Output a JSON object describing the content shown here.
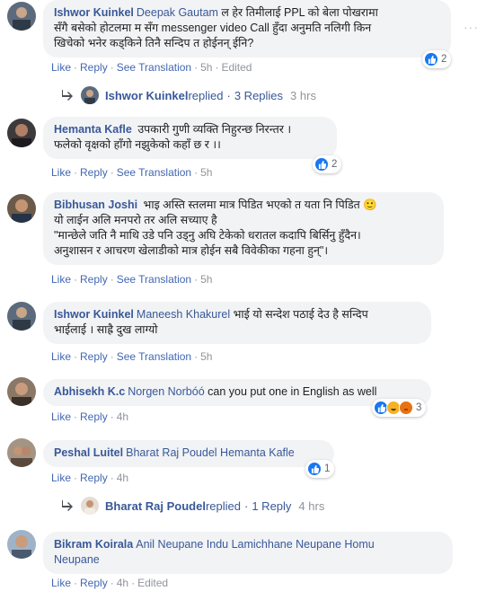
{
  "comments": [
    {
      "author": "Ishwor Kuinkel",
      "mention": "Deepak Gautam",
      "text_line1": " ल हेर तिमीलाई PPL को बेला पोखरामा",
      "text_line2": "सँगै बसेको होटलमा म सँग messenger video Call हुँदा अनुमति नलिगी किन",
      "text_line3": "खिचेको भनेर कड्किने तिनै सन्दिप त होईनन् ईनि?",
      "actions": {
        "like": "Like",
        "reply": "Reply",
        "translate": "See Translation",
        "time": "5h",
        "edited": "Edited"
      },
      "reaction_count": "2",
      "more": "···"
    },
    {
      "author": "Hemanta Kafle",
      "text_line1": " उपकारी गुणी व्यक्ति निहुरन्छ निरन्तर ।",
      "text_line2": "फलेको वृक्षको हाँगो नझुकेको कहाँ छ र ।।",
      "actions": {
        "like": "Like",
        "reply": "Reply",
        "translate": "See Translation",
        "time": "5h"
      },
      "reaction_count": "2"
    },
    {
      "author": "Bibhusan Joshi",
      "text_line1": " भाइ अस्ति स्तलमा मात्र पिडित भएको त यता नि पिडित",
      "text_line2": "यो लाईन अलि मनपरो तर अलि सच्याए है",
      "text_line3": "\"मान्छेले जति नै माथि उडे पनि उड्नु अघि टेकेको धरातल कदापि बिर्सिनु हुँदैन।",
      "text_line4": "अनुशासन र आचरण खेलाडीको मात्र होईन सबै विवेकीका गहना हुन्\"।",
      "actions": {
        "like": "Like",
        "reply": "Reply",
        "translate": "See Translation",
        "time": "5h"
      }
    },
    {
      "author": "Ishwor Kuinkel",
      "mention": "Maneesh Khakurel",
      "text_line1": " भाई यो सन्देश पठाई देउ है सन्दिप",
      "text_line2": "भाईलाई । साह्रै दुख लाग्यो",
      "actions": {
        "like": "Like",
        "reply": "Reply",
        "translate": "See Translation",
        "time": "5h"
      }
    },
    {
      "author": "Abhisekh K.c",
      "mention": "Norgen Norbóó",
      "text_line1": " can you put one in English as well",
      "actions": {
        "like": "Like",
        "reply": "Reply",
        "time": "4h"
      },
      "reaction_count": "3"
    },
    {
      "author": "Peshal Luitel",
      "mention": "Bharat Raj Poudel",
      "mention2": "Hemanta Kafle",
      "actions": {
        "like": "Like",
        "reply": "Reply",
        "time": "4h"
      },
      "reaction_count": "1"
    },
    {
      "author": "Bikram Koirala",
      "mention": "Anil Neupane",
      "mention2": "Indu Lamichhane Neupane",
      "mention3": "Homu",
      "mention3b": "Neupane",
      "actions": {
        "like": "Like",
        "reply": "Reply",
        "time": "4h",
        "edited": "Edited"
      }
    }
  ],
  "reply_threads": [
    {
      "name": "Ishwor Kuinkel",
      "replied": " replied",
      "count": "3 Replies",
      "sep": "·",
      "time": "3 hrs"
    },
    {
      "name": "Bharat Raj Poudel",
      "replied": " replied",
      "count": "1 Reply",
      "sep": "·",
      "time": "4 hrs"
    }
  ],
  "separator": "·",
  "emoji": "🙂",
  "colors": {
    "link": "#385898",
    "action": "#4267b2",
    "meta": "#90949c",
    "bubble": "#f2f3f5",
    "like": "#1877f2"
  }
}
